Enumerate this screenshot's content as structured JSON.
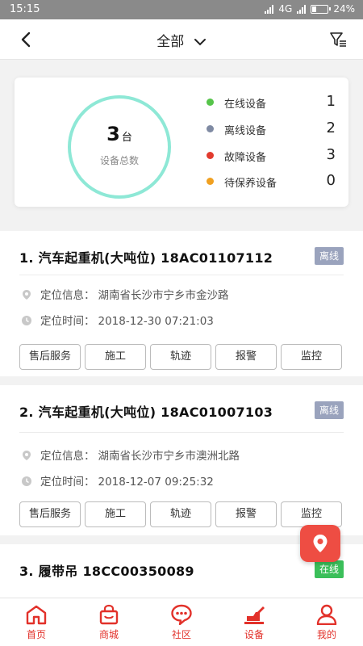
{
  "status_bar": {
    "time": "15:15",
    "network": "4G",
    "battery": "24%"
  },
  "header": {
    "title": "全部"
  },
  "summary": {
    "total_number": "3",
    "total_unit": "台",
    "total_caption": "设备总数",
    "stats": [
      {
        "label": "在线设备",
        "value": "1",
        "color": "#56c44a"
      },
      {
        "label": "离线设备",
        "value": "2",
        "color": "#7f8aa3"
      },
      {
        "label": "故障设备",
        "value": "3",
        "color": "#e23b2e"
      },
      {
        "label": "待保养设备",
        "value": "0",
        "color": "#f0a020"
      }
    ]
  },
  "devices": [
    {
      "title": "1. 汽车起重机(大吨位) 18AC01107112",
      "status": "离线",
      "location_label": "定位信息：",
      "location": "湖南省长沙市宁乡市金沙路",
      "time_label": "定位时间：",
      "time": "2018-12-30 07:21:03"
    },
    {
      "title": "2. 汽车起重机(大吨位) 18AC01007103",
      "status": "离线",
      "location_label": "定位信息：",
      "location": "湖南省长沙市宁乡市澳洲北路",
      "time_label": "定位时间：",
      "time": "2018-12-07 09:25:32"
    },
    {
      "title": "3. 履带吊 18CC00350089",
      "status": "在线"
    }
  ],
  "actions": [
    "售后服务",
    "施工",
    "轨迹",
    "报警",
    "监控"
  ],
  "tabbar": [
    {
      "label": "首页",
      "icon": "home-icon"
    },
    {
      "label": "商城",
      "icon": "shop-bag-icon"
    },
    {
      "label": "社区",
      "icon": "chat-bubble-icon"
    },
    {
      "label": "设备",
      "icon": "crane-icon"
    },
    {
      "label": "我的",
      "icon": "user-icon"
    }
  ],
  "colors": {
    "accent": "#e2312a",
    "ring": "#8ee8d6",
    "offline_tag": "#9aa3bd",
    "online_tag": "#3bbf5a"
  }
}
